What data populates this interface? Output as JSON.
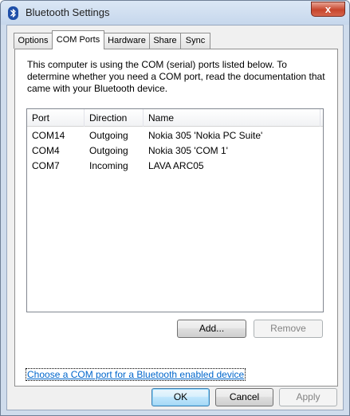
{
  "window": {
    "title": "Bluetooth Settings",
    "close_label": "x"
  },
  "tabs": [
    {
      "label": "Options",
      "active": false
    },
    {
      "label": "COM Ports",
      "active": true
    },
    {
      "label": "Hardware",
      "active": false
    },
    {
      "label": "Share",
      "active": false
    },
    {
      "label": "Sync",
      "active": false
    }
  ],
  "panel": {
    "description": "This computer is using the COM (serial) ports listed below. To determine whether you need a COM port, read the documentation that came with your Bluetooth device."
  },
  "table": {
    "columns": [
      "Port",
      "Direction",
      "Name"
    ],
    "rows": [
      {
        "port": "COM14",
        "direction": "Outgoing",
        "name": "Nokia 305 'Nokia PC Suite'"
      },
      {
        "port": "COM4",
        "direction": "Outgoing",
        "name": "Nokia 305 'COM 1'"
      },
      {
        "port": "COM7",
        "direction": "Incoming",
        "name": "LAVA ARC05"
      }
    ]
  },
  "buttons": {
    "add": "Add...",
    "remove": "Remove",
    "ok": "OK",
    "cancel": "Cancel",
    "apply": "Apply"
  },
  "link": {
    "text": "Choose a COM port for a Bluetooth enabled device"
  },
  "colors": {
    "bluetooth_blue": "#1f4fa8",
    "link": "#0066cc",
    "close_red": "#c7452c"
  },
  "icons": {
    "title": "bluetooth-icon",
    "close": "close-icon"
  }
}
